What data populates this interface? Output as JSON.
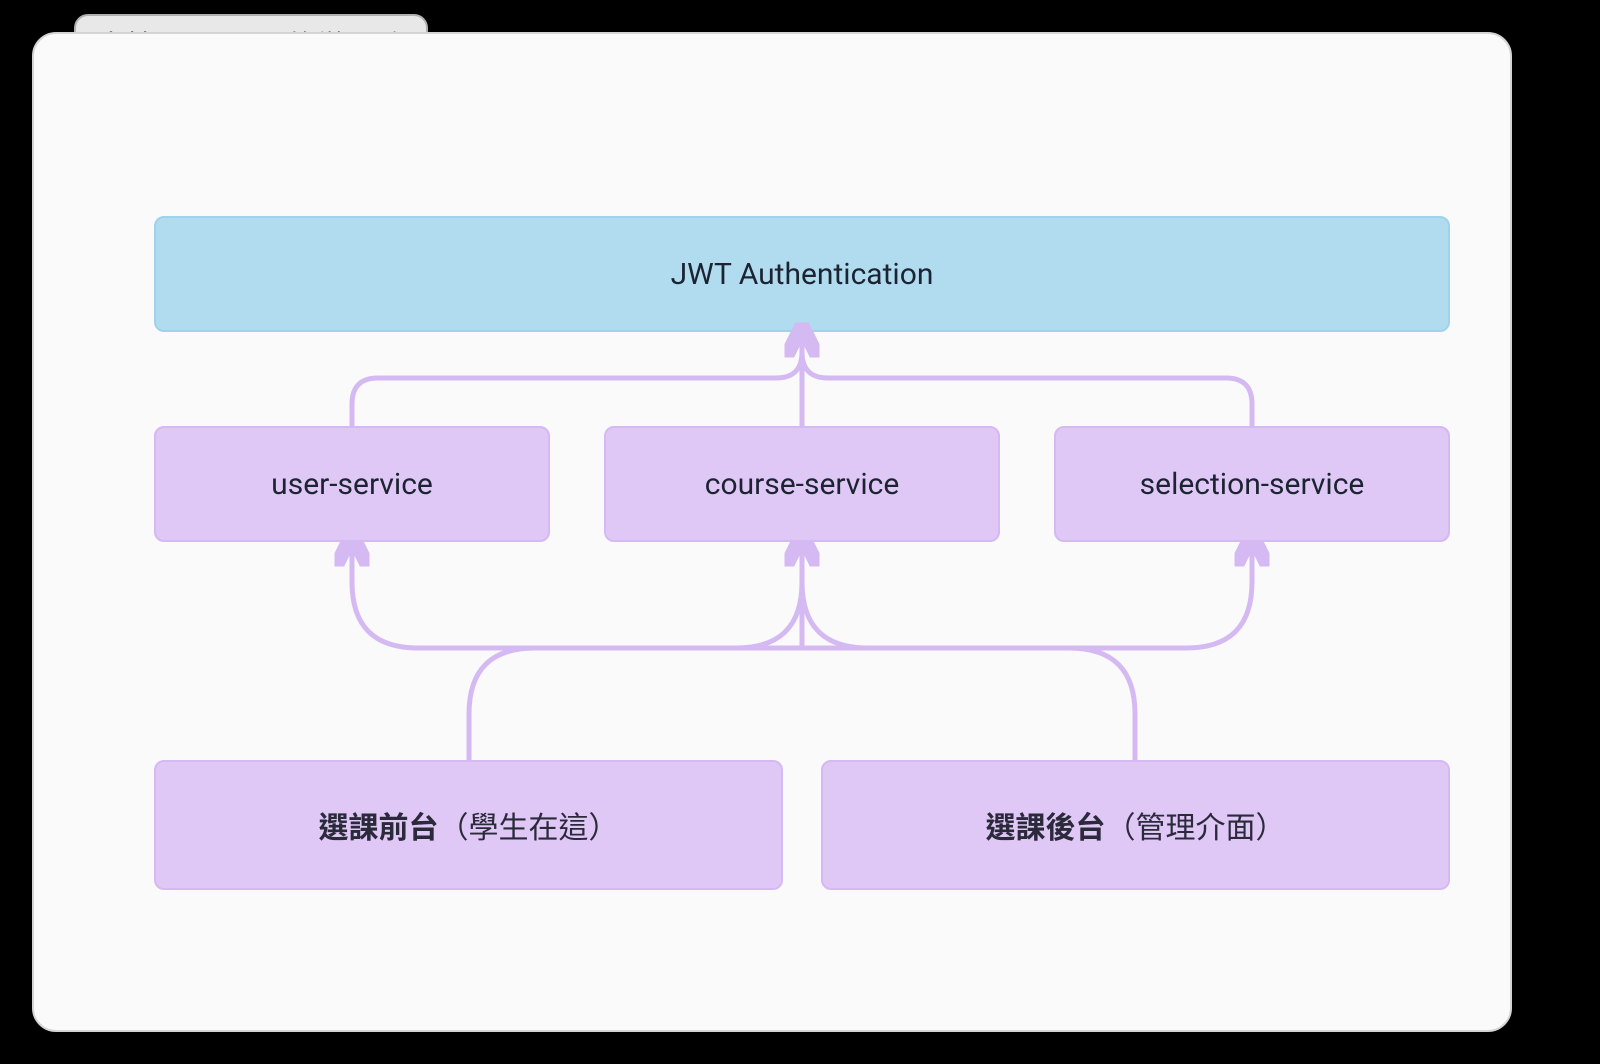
{
  "title": "去掉 Gateway 的微服務",
  "jwt": {
    "label": "JWT Authentication"
  },
  "services": [
    {
      "label": "user-service"
    },
    {
      "label": "course-service"
    },
    {
      "label": "selection-service"
    }
  ],
  "clients": [
    {
      "bold": "選課前台",
      "note": "（學生在這）"
    },
    {
      "bold": "選課後台",
      "note": "（管理介面）"
    }
  ],
  "colors": {
    "jwt_bg": "#b1dcef",
    "svc_bg": "#e0c8f6",
    "connector": "#d5b9f2"
  }
}
